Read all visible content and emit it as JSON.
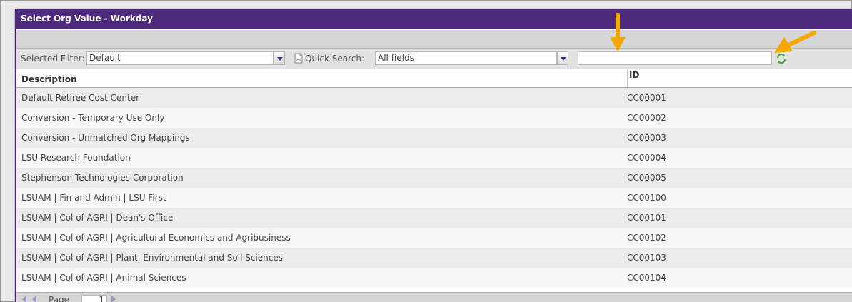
{
  "window": {
    "title": "Select Org Value - Workday"
  },
  "toolbar": {
    "filter_label": "Selected Filter:",
    "filter_value": "Default",
    "quick_search_label": "Quick Search:",
    "quick_search_field": "All fields",
    "search_value": ""
  },
  "grid": {
    "columns": [
      "Description",
      "ID"
    ],
    "rows": [
      {
        "description": "Default Retiree Cost Center",
        "id": "CC00001"
      },
      {
        "description": "Conversion - Temporary Use Only",
        "id": "CC00002"
      },
      {
        "description": "Conversion - Unmatched Org Mappings",
        "id": "CC00003"
      },
      {
        "description": "LSU Research Foundation",
        "id": "CC00004"
      },
      {
        "description": "Stephenson Technologies Corporation",
        "id": "CC00005"
      },
      {
        "description": "LSUAM | Fin and Admin | LSU First",
        "id": "CC00100"
      },
      {
        "description": "LSUAM | Col of AGRI | Dean's Office",
        "id": "CC00101"
      },
      {
        "description": "LSUAM | Col of AGRI | Agricultural Economics and Agribusiness",
        "id": "CC00102"
      },
      {
        "description": "LSUAM | Col of AGRI | Plant, Environmental and Soil Sciences",
        "id": "CC00103"
      },
      {
        "description": "LSUAM | Col of AGRI | Animal Sciences",
        "id": "CC00104"
      }
    ]
  },
  "pager": {
    "page_label": "Page",
    "page_number": "1"
  },
  "colors": {
    "title_bar": "#4d2a7c",
    "refresh": "#3aa63a",
    "annotation_arrow": "#f5a800"
  },
  "icons": {
    "refresh": "refresh-icon",
    "document": "document-icon",
    "dropdown": "chevron-down-icon"
  }
}
